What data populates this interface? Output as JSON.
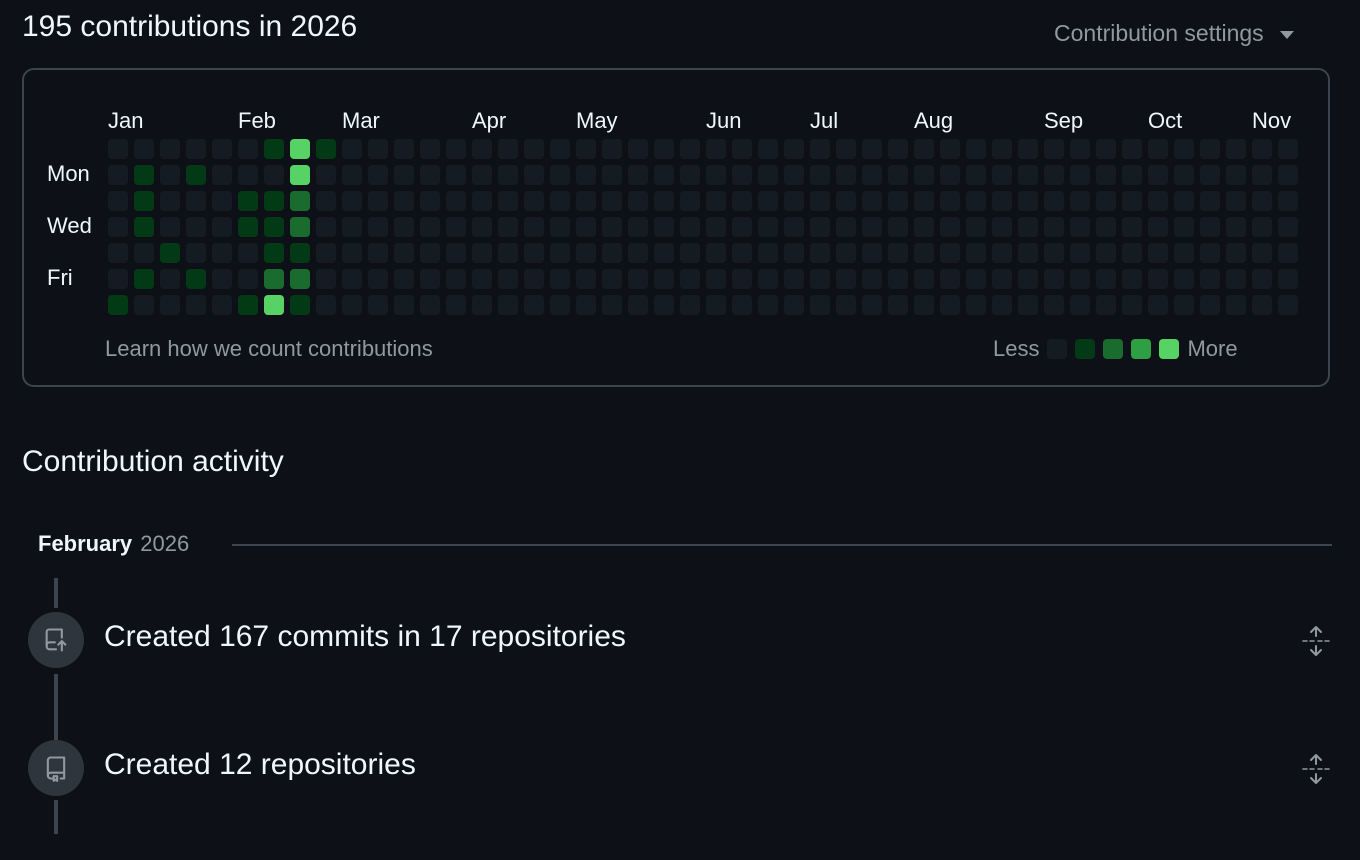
{
  "heading": "195 contributions in 2026",
  "settings": {
    "label": "Contribution settings",
    "icon": "triangle-down-icon"
  },
  "calendar": {
    "months": [
      "Jan",
      "Feb",
      "Mar",
      "Apr",
      "May",
      "Jun",
      "Jul",
      "Aug",
      "Sep",
      "Oct",
      "Nov"
    ],
    "day_labels": [
      "Mon",
      "Wed",
      "Fri"
    ],
    "level_colors": [
      "#151b23",
      "#033a16",
      "#196c2e",
      "#2ea043",
      "#56d364"
    ],
    "weeks": [
      [
        0,
        0,
        0,
        0,
        0,
        0,
        1
      ],
      [
        0,
        1,
        1,
        1,
        0,
        1,
        0
      ],
      [
        0,
        0,
        0,
        0,
        1,
        0,
        0
      ],
      [
        0,
        1,
        0,
        0,
        0,
        1,
        0
      ],
      [
        0,
        0,
        0,
        0,
        0,
        0,
        0
      ],
      [
        0,
        0,
        1,
        1,
        0,
        0,
        1
      ],
      [
        1,
        0,
        1,
        1,
        1,
        2,
        4
      ],
      [
        4,
        4,
        2,
        2,
        1,
        2,
        1
      ],
      [
        1,
        0,
        0,
        0,
        0,
        0,
        0
      ]
    ],
    "total_weeks": 46,
    "learn_link": "Learn how we count contributions",
    "legend": {
      "less": "Less",
      "more": "More"
    }
  },
  "activity": {
    "title": "Contribution activity",
    "month": "February",
    "year": "2026",
    "items": [
      {
        "text": "Created 167 commits in 17 repositories",
        "icon": "repo-push-icon",
        "toggle_icon": "fold-icon"
      },
      {
        "text": "Created 12 repositories",
        "icon": "repo-icon",
        "toggle_icon": "fold-icon"
      }
    ]
  }
}
